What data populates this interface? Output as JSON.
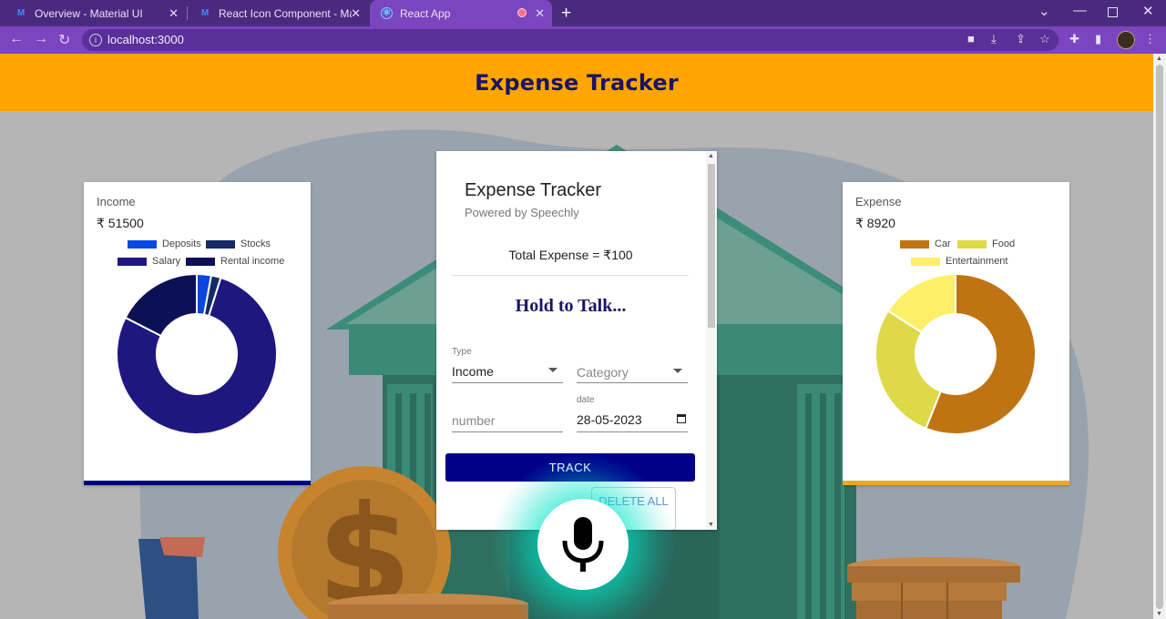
{
  "browser": {
    "tabs": [
      {
        "title": "Overview - Material UI",
        "active": false
      },
      {
        "title": "React Icon Component - Materia",
        "active": false
      },
      {
        "title": "React App",
        "active": true
      }
    ],
    "url": "localhost:3000"
  },
  "header": {
    "title": "Expense Tracker"
  },
  "income_card": {
    "label": "Income",
    "amount": "₹ 51500",
    "accent": "#000080",
    "chart_data": {
      "type": "pie",
      "categories": [
        "Deposits",
        "Stocks",
        "Salary",
        "Rental income"
      ],
      "values": [
        1500,
        1000,
        40000,
        9000
      ],
      "colors": [
        "#0a47e0",
        "#152a66",
        "#1f1780",
        "#0c1155"
      ]
    }
  },
  "expense_card": {
    "label": "Expense",
    "amount": "₹ 8920",
    "accent": "#f0a818",
    "chart_data": {
      "type": "pie",
      "categories": [
        "Car",
        "Food",
        "Entertainment"
      ],
      "values": [
        5000,
        2500,
        1420
      ],
      "colors": [
        "#bf7414",
        "#ddd948",
        "#fdf068"
      ]
    }
  },
  "form": {
    "title": "Expense Tracker",
    "subtitle": "Powered by Speechly",
    "total": "Total Expense = ₹100",
    "hold": "Hold to Talk...",
    "type_label": "Type",
    "type_value": "Income",
    "category_placeholder": "Category",
    "amount_placeholder": "number",
    "date_label": "date",
    "date_value": "28-05-2023",
    "track_label": "TRACK",
    "delete_label": "DELETE ALL"
  }
}
